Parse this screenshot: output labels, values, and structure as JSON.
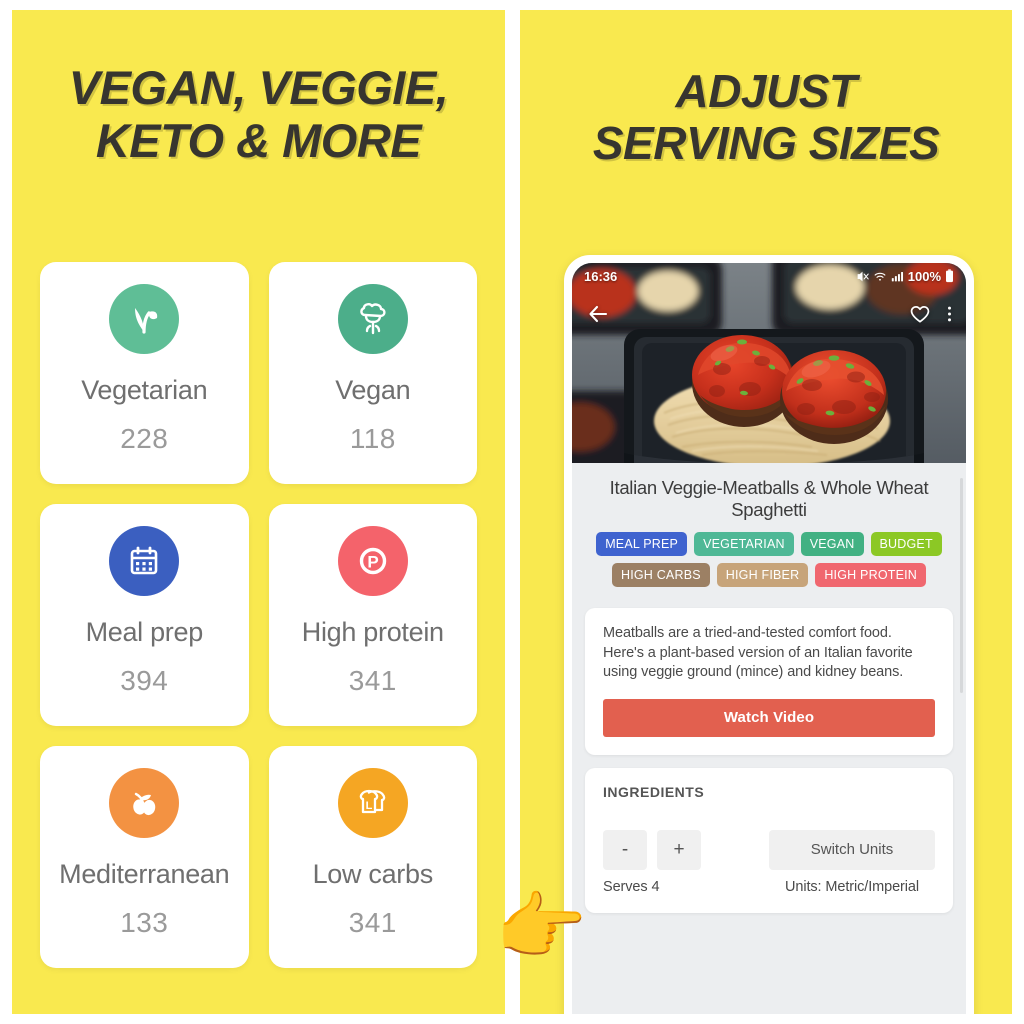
{
  "theme": {
    "background_yellow": "#F9E94F",
    "heading_color": "#37352F",
    "card_white": "#FFFFFF"
  },
  "left_panel": {
    "headline_line1": "VEGAN, VEGGIE,",
    "headline_line2": "KETO & MORE",
    "cards": [
      {
        "label": "Vegetarian",
        "count": "228",
        "icon": "sprout-icon",
        "icon_bg": "#5FBE96",
        "icon_fg": "#FFFFFF"
      },
      {
        "label": "Vegan",
        "count": "118",
        "icon": "broccoli-icon",
        "icon_bg": "#4CAE8A",
        "icon_fg": "#FFFFFF"
      },
      {
        "label": "Meal prep",
        "count": "394",
        "icon": "calendar-icon",
        "icon_bg": "#3B5FC0",
        "icon_fg": "#FFFFFF"
      },
      {
        "label": "High protein",
        "count": "341",
        "icon": "protein-p-icon",
        "icon_bg": "#F4636B",
        "icon_fg": "#FFFFFF"
      },
      {
        "label": "Mediterranean",
        "count": "133",
        "icon": "olives-icon",
        "icon_bg": "#F39242",
        "icon_fg": "#FFFFFF"
      },
      {
        "label": "Low carbs",
        "count": "341",
        "icon": "bread-l-icon",
        "icon_bg": "#F5A623",
        "icon_fg": "#FFFFFF"
      }
    ]
  },
  "right_panel": {
    "headline_line1": "ADJUST",
    "headline_line2": "SERVING SIZES",
    "phone": {
      "status_bar": {
        "time": "16:36",
        "battery_percent": "100%",
        "icons": [
          "mute-icon",
          "wifi-icon",
          "signal-icon",
          "battery-icon"
        ]
      },
      "hero_actions": {
        "back": "back-arrow-icon",
        "favorite": "heart-icon",
        "overflow": "more-vertical-icon"
      },
      "recipe": {
        "title": "Italian Veggie-Meatballs & Whole Wheat Spaghetti",
        "tags_row1": [
          {
            "label": "MEAL PREP",
            "color": "#3F63CF"
          },
          {
            "label": "VEGETARIAN",
            "color": "#4FB896"
          },
          {
            "label": "VEGAN",
            "color": "#42B183"
          },
          {
            "label": "BUDGET",
            "color": "#8CC825"
          }
        ],
        "tags_row2": [
          {
            "label": "HIGH CARBS",
            "color": "#9C8064"
          },
          {
            "label": "HIGH FIBER",
            "color": "#C7A47A"
          },
          {
            "label": "HIGH PROTEIN",
            "color": "#F0676F"
          }
        ],
        "description": "Meatballs are a tried-and-tested comfort food. Here's a plant-based version of an Italian favorite using veggie ground (mince) and kidney beans.",
        "watch_video_label": "Watch Video",
        "watch_video_color": "#E2604F"
      },
      "ingredients": {
        "heading": "INGREDIENTS",
        "decrement_label": "-",
        "increment_label": "+",
        "serves_text": "Serves 4",
        "switch_units_label": "Switch Units",
        "units_text": "Units: Metric/Imperial"
      }
    }
  },
  "annotation": {
    "pointer_hand": "👉"
  }
}
